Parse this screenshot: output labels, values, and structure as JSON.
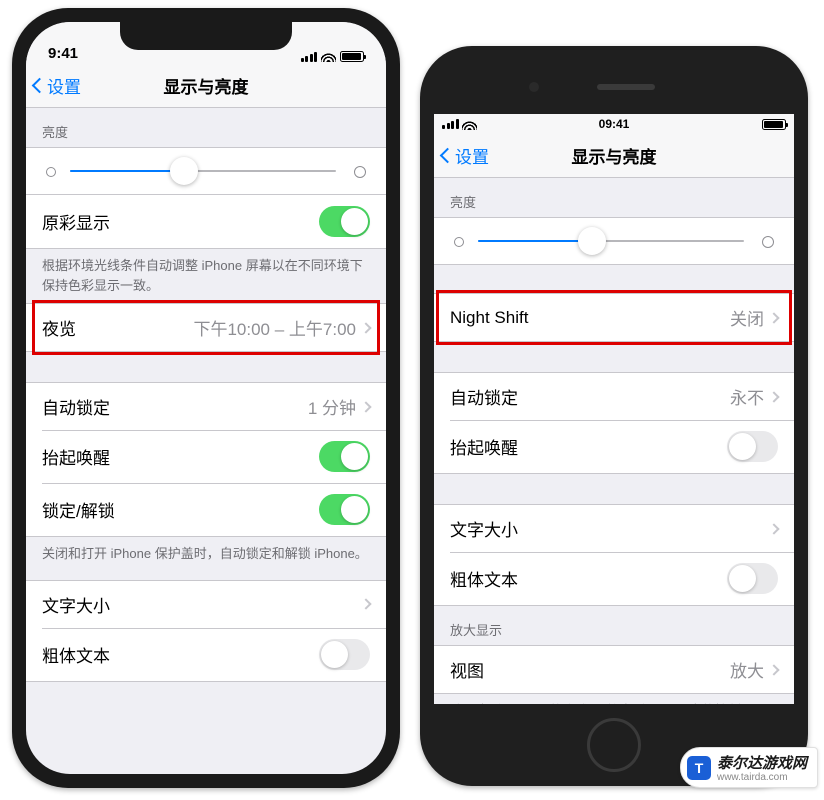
{
  "phone_x": {
    "status": {
      "time": "9:41"
    },
    "nav": {
      "back": "设置",
      "title": "显示与亮度"
    },
    "brightness": {
      "header": "亮度",
      "slider_percent": 43
    },
    "true_tone": {
      "label": "原彩显示",
      "on": true
    },
    "true_tone_footer": "根据环境光线条件自动调整 iPhone 屏幕以在不同环境下保持色彩显示一致。",
    "night_shift": {
      "label": "夜览",
      "value": "下午10:00 – 上午7:00"
    },
    "auto_lock": {
      "label": "自动锁定",
      "value": "1 分钟"
    },
    "raise_to_wake": {
      "label": "抬起唤醒",
      "on": true
    },
    "lock_unlock": {
      "label": "锁定/解锁",
      "on": true
    },
    "lock_unlock_footer": "关闭和打开 iPhone 保护盖时，自动锁定和解锁 iPhone。",
    "text_size": {
      "label": "文字大小"
    },
    "bold_text": {
      "label": "粗体文本",
      "on": false
    }
  },
  "phone_8": {
    "status": {
      "time": "09:41"
    },
    "nav": {
      "back": "设置",
      "title": "显示与亮度"
    },
    "brightness": {
      "header": "亮度",
      "slider_percent": 43
    },
    "night_shift": {
      "label": "Night Shift",
      "value": "关闭"
    },
    "auto_lock": {
      "label": "自动锁定",
      "value": "永不"
    },
    "raise_to_wake": {
      "label": "抬起唤醒",
      "on": false
    },
    "text_size": {
      "label": "文字大小"
    },
    "bold_text": {
      "label": "粗体文本",
      "on": false
    },
    "zoom_header": "放大显示",
    "zoom": {
      "label": "视图",
      "value": "放大"
    },
    "zoom_footer": "选取查看 iPhone 的方式。\"放大\"会显示更大的控制项。\"标准\"会显示更多的内容。"
  },
  "watermark": {
    "text": "泰尔达游戏网",
    "url": "www.tairda.com"
  }
}
